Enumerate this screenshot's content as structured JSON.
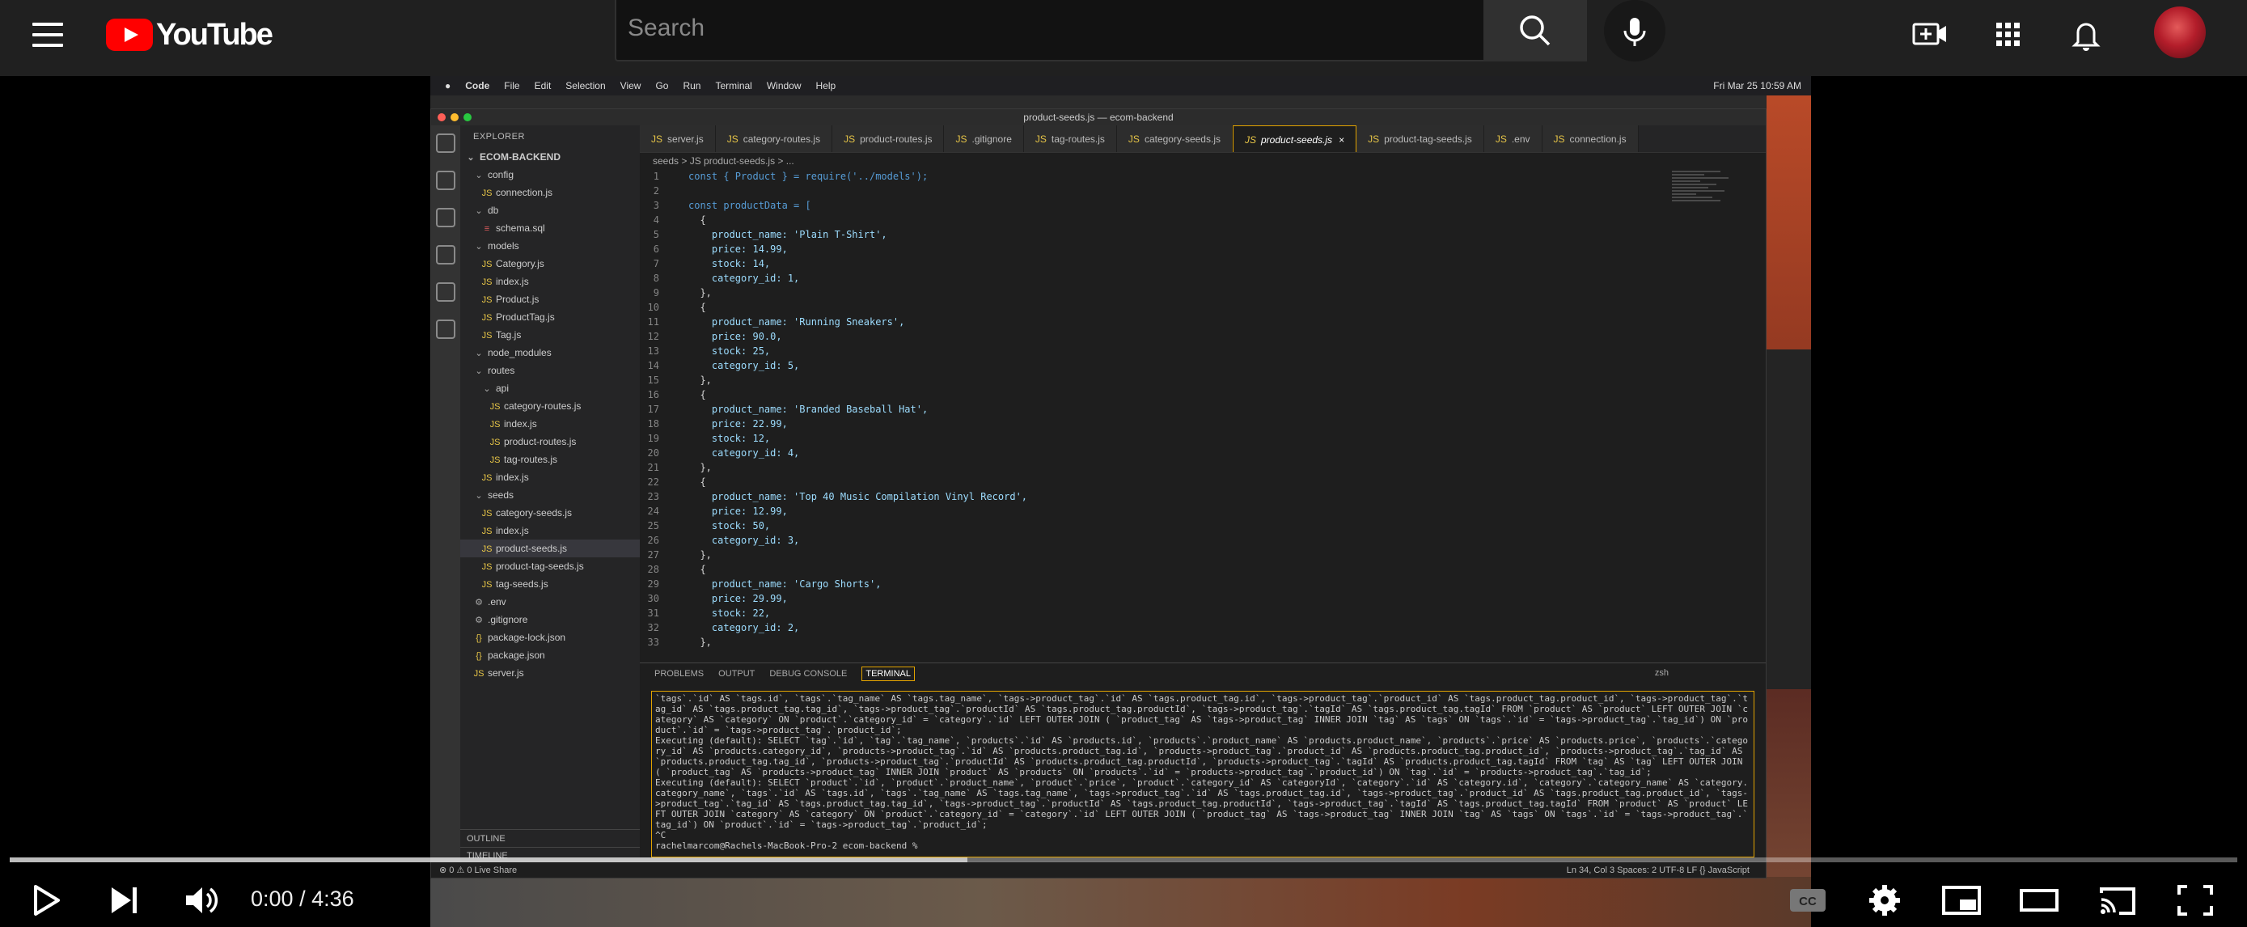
{
  "yt": {
    "logo_text": "YouTube",
    "search_placeholder": "Search"
  },
  "player": {
    "current_time": "0:00",
    "separator": " / ",
    "duration": "4:36",
    "buffered_fraction": 0.43
  },
  "mac_menu": {
    "items": [
      "Code",
      "File",
      "Edit",
      "Selection",
      "View",
      "Go",
      "Run",
      "Terminal",
      "Window",
      "Help"
    ],
    "clock": "Fri Mar 25  10:59 AM"
  },
  "vscode": {
    "window_title": "product-seeds.js — ecom-backend",
    "explorer_label": "EXPLORER",
    "project": "ECOM-BACKEND",
    "tree": [
      {
        "text": "config",
        "type": "fold",
        "depth": 1
      },
      {
        "text": "connection.js",
        "type": "js",
        "depth": 2
      },
      {
        "text": "db",
        "type": "fold",
        "depth": 1
      },
      {
        "text": "schema.sql",
        "type": "sql",
        "depth": 2
      },
      {
        "text": "models",
        "type": "fold",
        "depth": 1
      },
      {
        "text": "Category.js",
        "type": "js",
        "depth": 2
      },
      {
        "text": "index.js",
        "type": "js",
        "depth": 2
      },
      {
        "text": "Product.js",
        "type": "js",
        "depth": 2
      },
      {
        "text": "ProductTag.js",
        "type": "js",
        "depth": 2
      },
      {
        "text": "Tag.js",
        "type": "js",
        "depth": 2
      },
      {
        "text": "node_modules",
        "type": "fold",
        "depth": 1
      },
      {
        "text": "routes",
        "type": "fold",
        "depth": 1
      },
      {
        "text": "api",
        "type": "fold",
        "depth": 2
      },
      {
        "text": "category-routes.js",
        "type": "js",
        "depth": 3
      },
      {
        "text": "index.js",
        "type": "js",
        "depth": 3
      },
      {
        "text": "product-routes.js",
        "type": "js",
        "depth": 3
      },
      {
        "text": "tag-routes.js",
        "type": "js",
        "depth": 3
      },
      {
        "text": "index.js",
        "type": "js",
        "depth": 2
      },
      {
        "text": "seeds",
        "type": "fold",
        "depth": 1
      },
      {
        "text": "category-seeds.js",
        "type": "js",
        "depth": 2
      },
      {
        "text": "index.js",
        "type": "js",
        "depth": 2
      },
      {
        "text": "product-seeds.js",
        "type": "js",
        "depth": 2
      },
      {
        "text": "product-tag-seeds.js",
        "type": "js",
        "depth": 2
      },
      {
        "text": "tag-seeds.js",
        "type": "js",
        "depth": 2
      },
      {
        "text": ".env",
        "type": "env",
        "depth": 1
      },
      {
        "text": ".gitignore",
        "type": "env",
        "depth": 1
      },
      {
        "text": "package-lock.json",
        "type": "json",
        "depth": 1
      },
      {
        "text": "package.json",
        "type": "json",
        "depth": 1
      },
      {
        "text": "server.js",
        "type": "js",
        "depth": 1
      }
    ],
    "outline_label": "OUTLINE",
    "timeline_label": "TIMELINE",
    "tabs": [
      {
        "label": "server.js",
        "active": false
      },
      {
        "label": "category-routes.js",
        "active": false
      },
      {
        "label": "product-routes.js",
        "active": false
      },
      {
        "label": ".gitignore",
        "active": false
      },
      {
        "label": "tag-routes.js",
        "active": false
      },
      {
        "label": "category-seeds.js",
        "active": false
      },
      {
        "label": "product-seeds.js",
        "active": true
      },
      {
        "label": "product-tag-seeds.js",
        "active": false
      },
      {
        "label": ".env",
        "active": false
      },
      {
        "label": "connection.js",
        "active": false
      }
    ],
    "breadcrumb": "seeds  >  JS product-seeds.js  >  ...",
    "code_lines": [
      "const { Product } = require('../models');",
      "",
      "const productData = [",
      "  {",
      "    product_name: 'Plain T-Shirt',",
      "    price: 14.99,",
      "    stock: 14,",
      "    category_id: 1,",
      "  },",
      "  {",
      "    product_name: 'Running Sneakers',",
      "    price: 90.0,",
      "    stock: 25,",
      "    category_id: 5,",
      "  },",
      "  {",
      "    product_name: 'Branded Baseball Hat',",
      "    price: 22.99,",
      "    stock: 12,",
      "    category_id: 4,",
      "  },",
      "  {",
      "    product_name: 'Top 40 Music Compilation Vinyl Record',",
      "    price: 12.99,",
      "    stock: 50,",
      "    category_id: 3,",
      "  },",
      "  {",
      "    product_name: 'Cargo Shorts',",
      "    price: 29.99,",
      "    stock: 22,",
      "    category_id: 2,",
      "  },"
    ],
    "panel_tabs": [
      "PROBLEMS",
      "OUTPUT",
      "DEBUG CONSOLE",
      "TERMINAL"
    ],
    "active_panel_tab": "TERMINAL",
    "terminal_shell": "zsh",
    "terminal_lines": [
      "`tags`.`id` AS `tags.id`, `tags`.`tag_name` AS `tags.tag_name`, `tags->product_tag`.`id` AS `tags.product_tag.id`, `tags->product_tag`.`product_id` AS `tags.product_tag.product_id`, `tags->product_tag`.`tag_id` AS `tags.product_tag.tag_id`, `tags->product_tag`.`productId` AS `tags.product_tag.productId`, `tags->product_tag`.`tagId` AS `tags.product_tag.tagId` FROM `product` AS `product` LEFT OUTER JOIN `category` AS `category` ON `product`.`category_id` = `category`.`id` LEFT OUTER JOIN ( `product_tag` AS `tags->product_tag` INNER JOIN `tag` AS `tags` ON `tags`.`id` = `tags->product_tag`.`tag_id`) ON `product`.`id` = `tags->product_tag`.`product_id`;",
      "Executing (default): SELECT `tag`.`id`, `tag`.`tag_name`, `products`.`id` AS `products.id`, `products`.`product_name` AS `products.product_name`, `products`.`price` AS `products.price`, `products`.`category_id` AS `products.category_id`, `products->product_tag`.`id` AS `products.product_tag.id`, `products->product_tag`.`product_id` AS `products.product_tag.product_id`, `products->product_tag`.`tag_id` AS `products.product_tag.tag_id`, `products->product_tag`.`productId` AS `products.product_tag.productId`, `products->product_tag`.`tagId` AS `products.product_tag.tagId` FROM `tag` AS `tag` LEFT OUTER JOIN ( `product_tag` AS `products->product_tag` INNER JOIN `product` AS `products` ON `products`.`id` = `products->product_tag`.`product_id`) ON `tag`.`id` = `products->product_tag`.`tag_id`;",
      "Executing (default): SELECT `product`.`id`, `product`.`product_name`, `product`.`price`, `product`.`category_id` AS `categoryId`, `category`.`id` AS `category.id`, `category`.`category_name` AS `category.category_name`, `tags`.`id` AS `tags.id`, `tags`.`tag_name` AS `tags.tag_name`, `tags->product_tag`.`id` AS `tags.product_tag.id`, `tags->product_tag`.`product_id` AS `tags.product_tag.product_id`, `tags->product_tag`.`tag_id` AS `tags.product_tag.tag_id`, `tags->product_tag`.`productId` AS `tags.product_tag.productId`, `tags->product_tag`.`tagId` AS `tags.product_tag.tagId` FROM `product` AS `product` LEFT OUTER JOIN `category` AS `category` ON `product`.`category_id` = `category`.`id` LEFT OUTER JOIN ( `product_tag` AS `tags->product_tag` INNER JOIN `tag` AS `tags` ON `tags`.`id` = `tags->product_tag`.`tag_id`) ON `product`.`id` = `tags->product_tag`.`product_id`;",
      "^C",
      "rachelmarcom@Rachels-MacBook-Pro-2 ecom-backend % "
    ],
    "status_left": "⊗ 0  ⚠ 0   Live Share",
    "status_right": "Ln 34, Col 3    Spaces: 2    UTF-8    LF    {} JavaScript"
  },
  "colors": {
    "yt_bar": "#202020",
    "yt_red": "#ff0000",
    "vscode_bg": "#1e1e1e",
    "highlight_border": "#e2a300"
  }
}
